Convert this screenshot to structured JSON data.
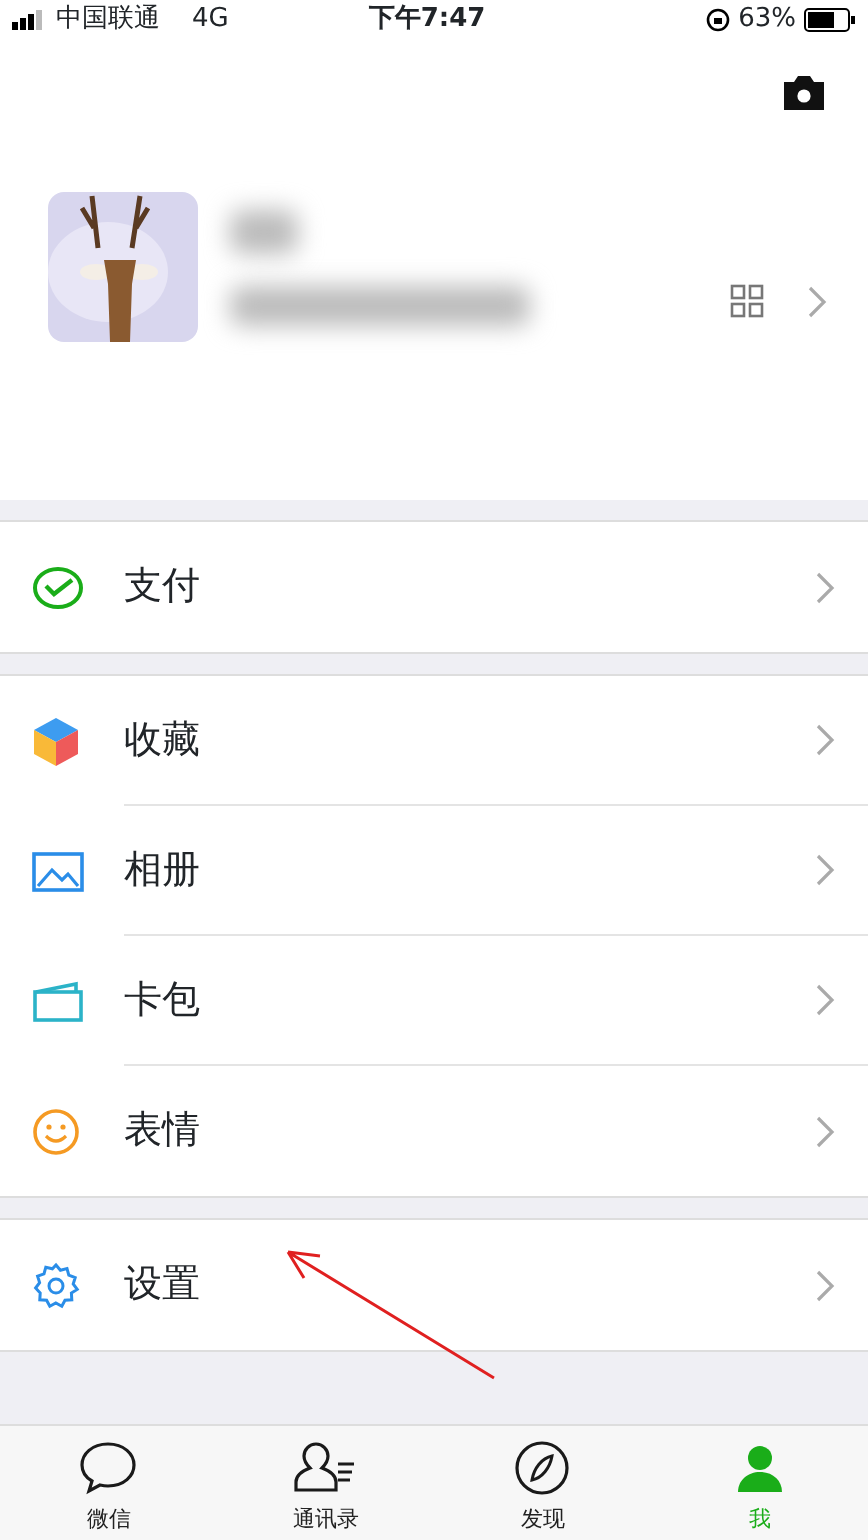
{
  "status_bar": {
    "carrier": "中国联通",
    "network": "4G",
    "time": "下午7:47",
    "battery": "63%"
  },
  "groups": [
    {
      "items": [
        {
          "label": "支付",
          "kind": "pay"
        }
      ]
    },
    {
      "items": [
        {
          "label": "收藏",
          "kind": "favorites"
        },
        {
          "label": "相册",
          "kind": "album"
        },
        {
          "label": "卡包",
          "kind": "cards"
        },
        {
          "label": "表情",
          "kind": "stickers"
        }
      ]
    },
    {
      "items": [
        {
          "label": "设置",
          "kind": "settings"
        }
      ]
    }
  ],
  "tab_bar": [
    {
      "label": "微信",
      "kind": "chats",
      "selected": false
    },
    {
      "label": "通讯录",
      "kind": "contacts",
      "selected": false
    },
    {
      "label": "发现",
      "kind": "discover",
      "selected": false
    },
    {
      "label": "我",
      "kind": "me",
      "selected": true
    }
  ]
}
